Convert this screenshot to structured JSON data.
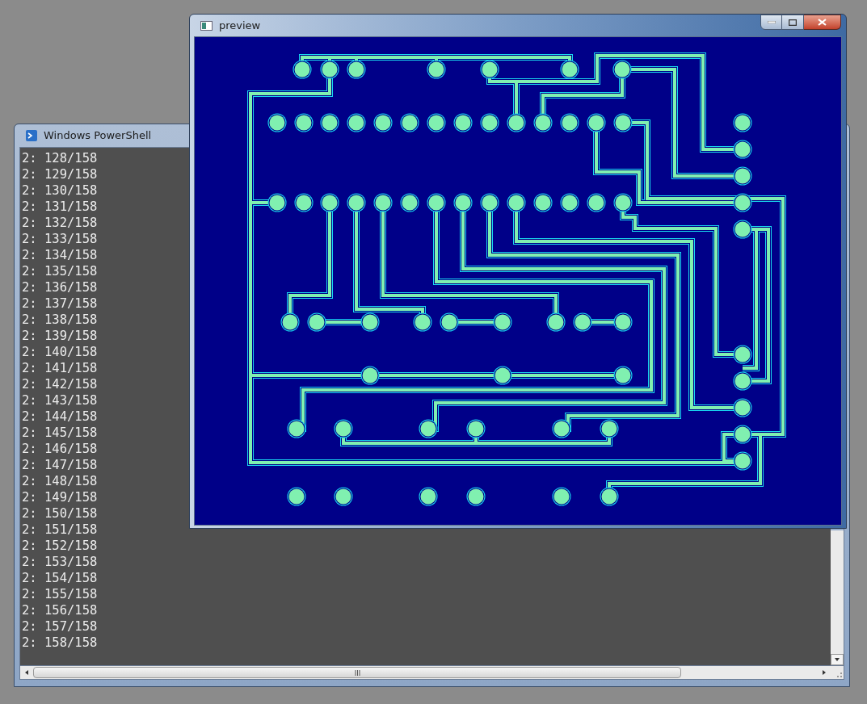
{
  "console_window": {
    "title": "Windows PowerShell",
    "lines": [
      "2: 128/158",
      "2: 129/158",
      "2: 130/158",
      "2: 131/158",
      "2: 132/158",
      "2: 133/158",
      "2: 134/158",
      "2: 135/158",
      "2: 136/158",
      "2: 137/158",
      "2: 138/158",
      "2: 139/158",
      "2: 140/158",
      "2: 141/158",
      "2: 142/158",
      "2: 143/158",
      "2: 144/158",
      "2: 145/158",
      "2: 146/158",
      "2: 147/158",
      "2: 148/158",
      "2: 149/158",
      "2: 150/158",
      "2: 151/158",
      "2: 152/158",
      "2: 153/158",
      "2: 154/158",
      "2: 155/158",
      "2: 156/158",
      "2: 157/158",
      "2: 158/158"
    ]
  },
  "preview_window": {
    "title": "preview"
  }
}
